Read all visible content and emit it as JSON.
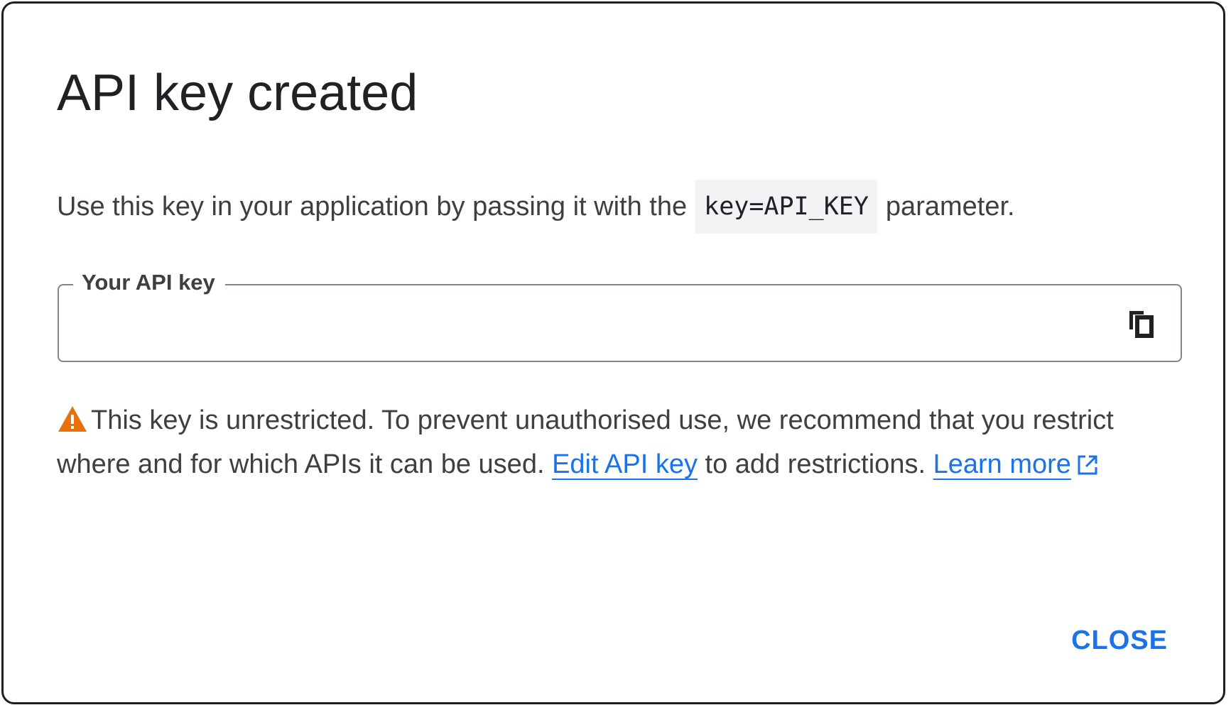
{
  "dialog": {
    "title": "API key created",
    "description": {
      "prefix": "Use this key in your application by passing it with the",
      "code": "key=API_KEY",
      "suffix": "parameter."
    },
    "api_key_field": {
      "label": "Your API key",
      "value": "",
      "copy_icon": "content-copy-icon"
    },
    "warning": {
      "icon": "warning-triangle-icon",
      "icon_color": "#e8710a",
      "text_before": "This key is unrestricted. To prevent unauthorised use, we recommend that you restrict where and for which APIs it can be used.",
      "edit_link": "Edit API key",
      "text_middle": "to add restrictions.",
      "learn_more_link": "Learn more",
      "external_icon": "open-in-new-icon"
    },
    "close_label": "CLOSE"
  },
  "colors": {
    "accent": "#1a73e8",
    "text": "#3c4043",
    "code_bg": "#f1f3f4",
    "warning": "#e8710a"
  }
}
